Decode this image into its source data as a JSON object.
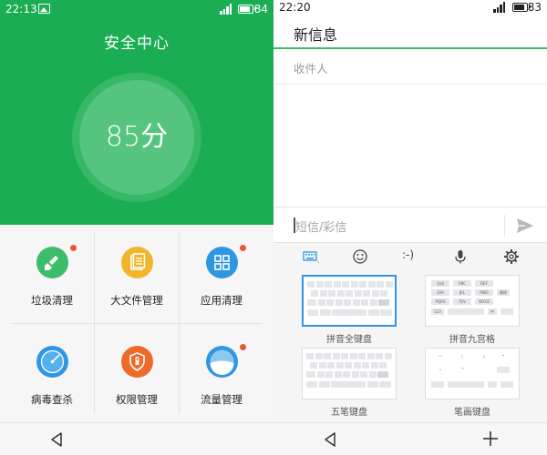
{
  "left": {
    "status": {
      "time": "22:13",
      "battery": "84"
    },
    "title": "安全中心",
    "score": "85分",
    "colors": {
      "header": "#1aad53",
      "badge": "#e8553d"
    },
    "tiles": [
      {
        "label": "垃圾清理",
        "icon": "broom-icon",
        "color": "#3dbc6a",
        "badge": true
      },
      {
        "label": "大文件管理",
        "icon": "document-icon",
        "color": "#f0b52a",
        "badge": false
      },
      {
        "label": "应用清理",
        "icon": "app-grid-icon",
        "color": "#2f96e3",
        "badge": true
      },
      {
        "label": "病毒查杀",
        "icon": "radar-icon",
        "color": "#2f96e3",
        "badge": false
      },
      {
        "label": "权限管理",
        "icon": "shield-icon",
        "color": "#ee6a2a",
        "badge": false
      },
      {
        "label": "流量管理",
        "icon": "data-gauge-icon",
        "color": "#2f96e3",
        "badge": true
      }
    ],
    "nav": {
      "back_icon": "back-triangle-icon"
    }
  },
  "right": {
    "status": {
      "time": "22:20",
      "battery": "83"
    },
    "title": "新信息",
    "recipient_placeholder": "收件人",
    "message_placeholder": "短信/彩信",
    "send_icon": "send-icon",
    "toolbar": [
      {
        "icon": "keyboard-icon"
      },
      {
        "icon": "emoji-icon"
      },
      {
        "text": ":-)"
      },
      {
        "icon": "microphone-icon"
      },
      {
        "icon": "gear-icon"
      }
    ],
    "keyboards": [
      {
        "label": "拼音全键盘",
        "selected": true
      },
      {
        "label": "拼音九宫格",
        "selected": false
      },
      {
        "label": "五笔键盘",
        "selected": false
      },
      {
        "label": "笔画键盘",
        "selected": false
      }
    ],
    "nine_grid_keys": [
      "分词",
      "ABC",
      "DEF",
      "GHI",
      "JKL",
      "MNO",
      "PQRS",
      "TUV",
      "WXYZ",
      "123",
      "中",
      "删除"
    ],
    "stroke_keys": [
      "一",
      "丨",
      "丿",
      "丶",
      "乛",
      "*"
    ],
    "nav": {
      "back_icon": "back-triangle-icon",
      "add_icon": "plus-icon"
    }
  }
}
